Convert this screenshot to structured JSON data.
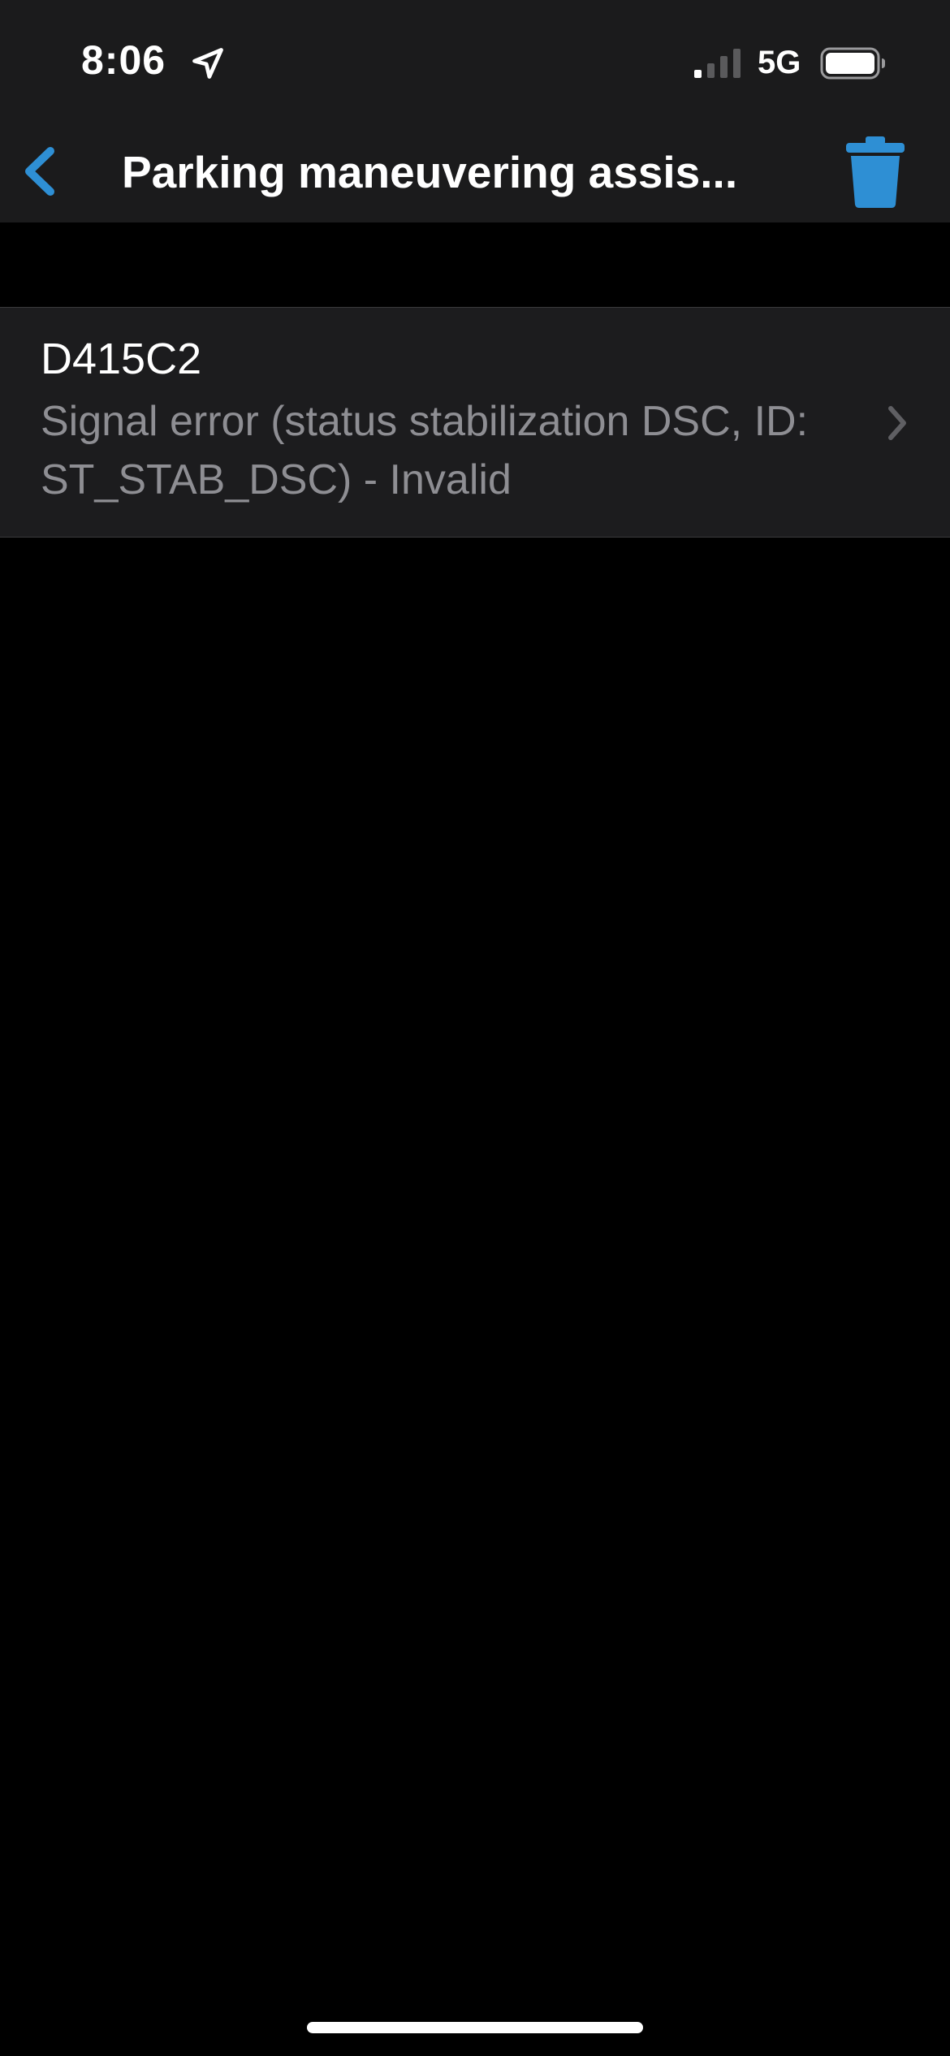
{
  "status_bar": {
    "time": "8:06",
    "network": "5G",
    "icons": [
      "location-arrow-icon",
      "cellular-signal-icon",
      "battery-icon"
    ]
  },
  "nav": {
    "title": "Parking maneuvering assis...",
    "back_icon": "chevron-left-icon",
    "delete_icon": "trash-icon"
  },
  "fault_list": [
    {
      "code": "D415C2",
      "description": "Signal error (status stabilization DSC, ID: ST_STAB_DSC) - Invalid"
    }
  ],
  "colors": {
    "accent": "#2e8fd4",
    "background": "#000000",
    "bar_background": "#1b1b1c",
    "cell_background": "#1c1c1e",
    "secondary_text": "#8e8e93"
  }
}
